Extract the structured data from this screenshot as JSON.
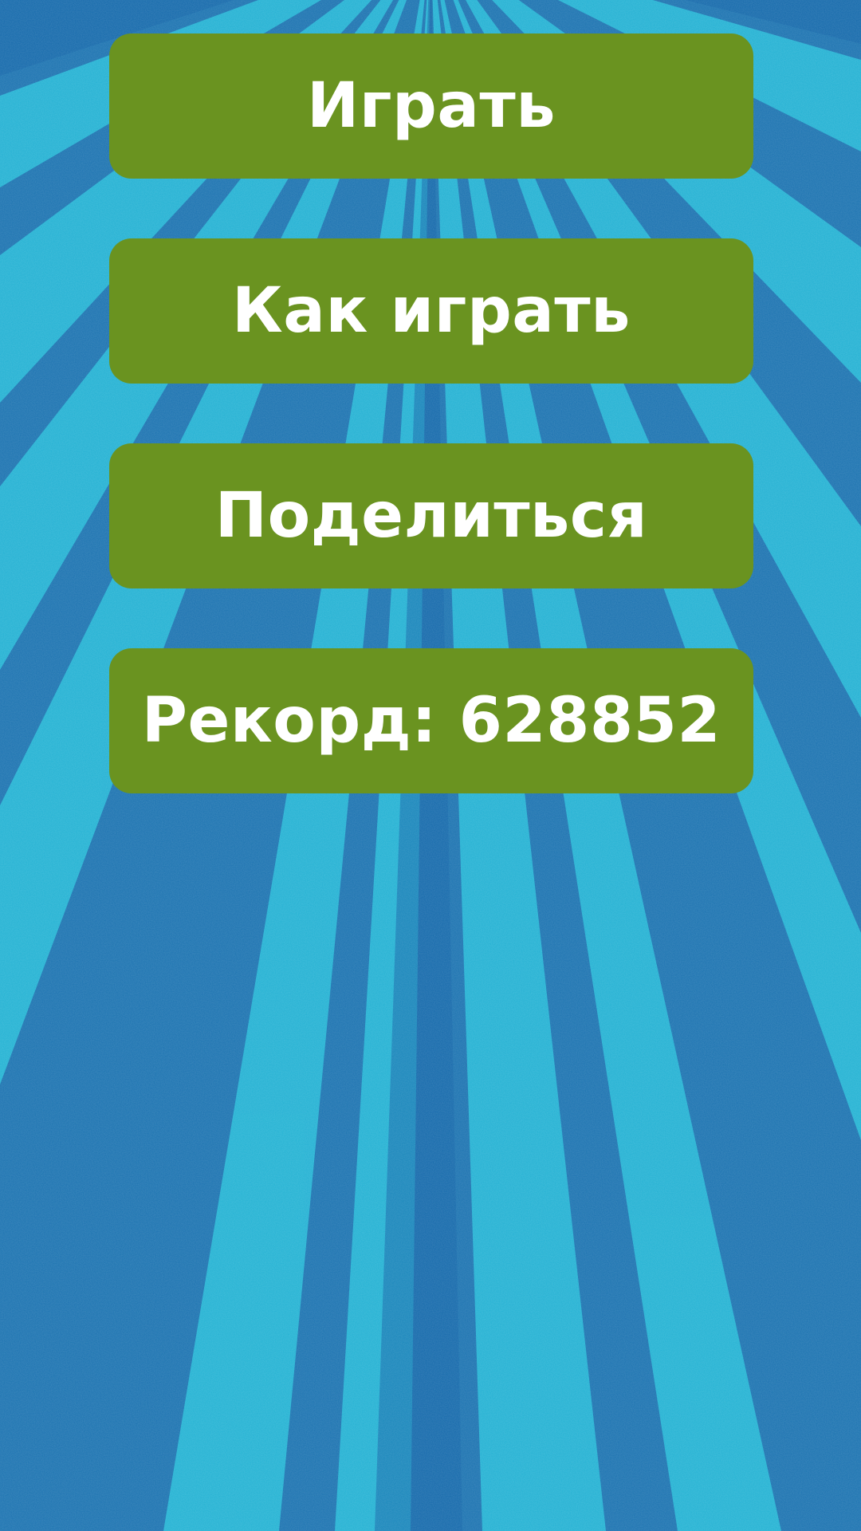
{
  "background": {
    "base_color": "#1a72b0",
    "ray_color": "#23b7d6",
    "dark_ray_color": "#1163a7"
  },
  "menu": {
    "button_color": "#6a9320",
    "text_color": "#ffffff",
    "buttons": [
      {
        "id": "play",
        "label": "Играть"
      },
      {
        "id": "how-to-play",
        "label": "Как играть"
      },
      {
        "id": "share",
        "label": "Поделиться"
      }
    ],
    "record": {
      "label": "Рекорд: 628852",
      "value": 628852
    }
  }
}
